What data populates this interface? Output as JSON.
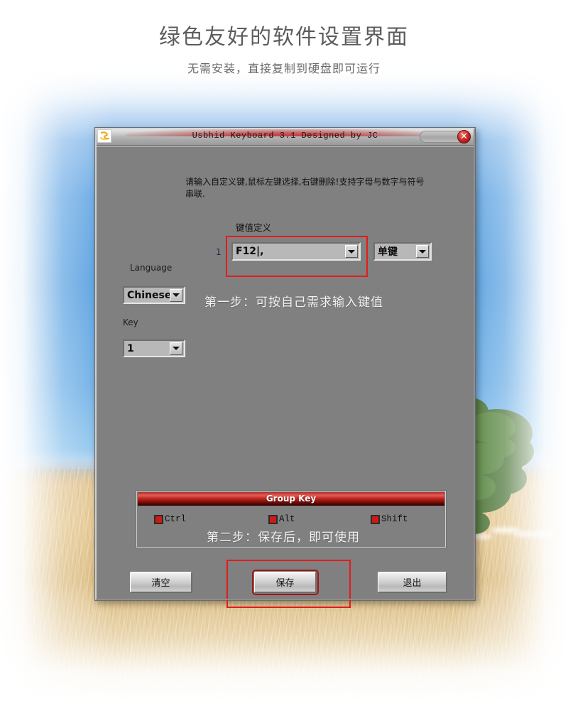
{
  "page": {
    "heading_main": "绿色友好的软件设置界面",
    "heading_sub": "无需安装，直接复制到硬盘即可运行"
  },
  "dialog": {
    "title": "Usbhid Keyboard 3.1 Designed by JC",
    "icon": "app-icon",
    "close_label": "✕",
    "instruction": "请输入自定义键,鼠标左键选择,右键删除!支持字母与数字与符号串联.",
    "keydef_label": "键值定义",
    "row_number": "1",
    "key_value": "F12|,",
    "key_type": "单键",
    "language_label": "Language",
    "language_value": "Chinese",
    "key_label": "Key",
    "key_index_value": "1",
    "group_panel": {
      "title": "Group Key",
      "items": [
        {
          "label": "Ctrl",
          "checked": true
        },
        {
          "label": "Alt",
          "checked": true
        },
        {
          "label": "Shift",
          "checked": true
        }
      ]
    },
    "buttons": {
      "clear": "清空",
      "save": "保存",
      "exit": "退出"
    }
  },
  "annotations": {
    "step1": "第一步：可按自己需求输入键值",
    "step2": "第二步：保存后，即可使用",
    "highlight_color": "#e41b1b"
  },
  "colors": {
    "dialog_face": "#808080",
    "accent_red": "#cc1b17",
    "sky_blue": "#4d9ade",
    "field_gold": "#e2c184"
  }
}
